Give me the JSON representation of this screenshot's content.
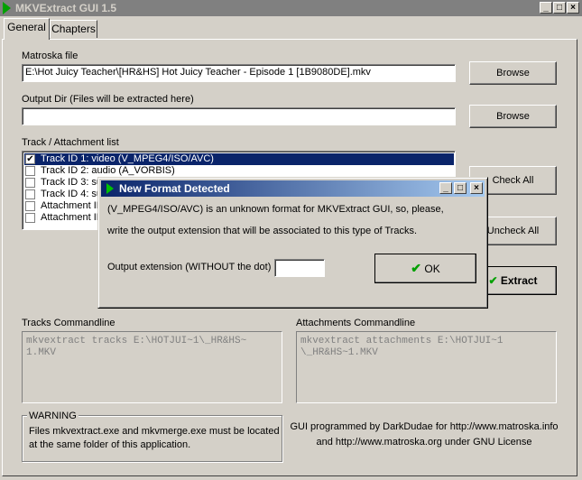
{
  "window": {
    "title": "MKVExtract GUI 1.5"
  },
  "tabs": [
    {
      "label": "General"
    },
    {
      "label": "Chapters"
    }
  ],
  "matroska": {
    "label": "Matroska file",
    "value": "E:\\Hot Juicy Teacher\\[HR&HS] Hot Juicy Teacher - Episode 1 [1B9080DE].mkv",
    "browse": "Browse"
  },
  "output": {
    "label": "Output Dir (Files will be extracted here)",
    "value": "",
    "browse": "Browse"
  },
  "tracks": {
    "label": "Track / Attachment list",
    "items": [
      {
        "text": "Track ID 1: video (V_MPEG4/ISO/AVC)",
        "checked": true,
        "selected": true
      },
      {
        "text": "Track ID 2: audio (A_VORBIS)",
        "checked": false,
        "selected": false
      },
      {
        "text": "Track ID 3: su",
        "checked": false,
        "selected": false
      },
      {
        "text": "Track ID 4: su",
        "checked": false,
        "selected": false
      },
      {
        "text": "Attachment ID",
        "checked": false,
        "selected": false
      },
      {
        "text": "Attachment ID",
        "checked": false,
        "selected": false
      }
    ]
  },
  "buttons": {
    "check_all": "Check All",
    "uncheck_all": "Uncheck All",
    "extract": "Extract"
  },
  "tracks_cmd": {
    "label": "Tracks Commandline",
    "text": "mkvextract tracks E:\\HOTJUI~1\\_HR&HS~\n1.MKV"
  },
  "attach_cmd": {
    "label": "Attachments Commandline",
    "text": "mkvextract attachments E:\\HOTJUI~1\n\\_HR&HS~1.MKV"
  },
  "warning": {
    "title": "WARNING",
    "line1": "Files mkvextract.exe and mkvmerge.exe must be located",
    "line2": "at the same folder of this application."
  },
  "credits": {
    "line1": "GUI programmed by DarkDudae for http://www.matroska.info",
    "line2": "and http://www.matroska.org under GNU License"
  },
  "dialog": {
    "title": "New Format Detected",
    "message1": "(V_MPEG4/ISO/AVC) is an unknown format for MKVExtract GUI, so, please,",
    "message2": "write the output extension that will be associated to this type of Tracks.",
    "ext_label": "Output extension (WITHOUT the dot)",
    "ext_value": "",
    "ok": "OK"
  },
  "colors": {
    "face": "#d4d0c8",
    "selection": "#0a246a",
    "check": "#00a000"
  }
}
